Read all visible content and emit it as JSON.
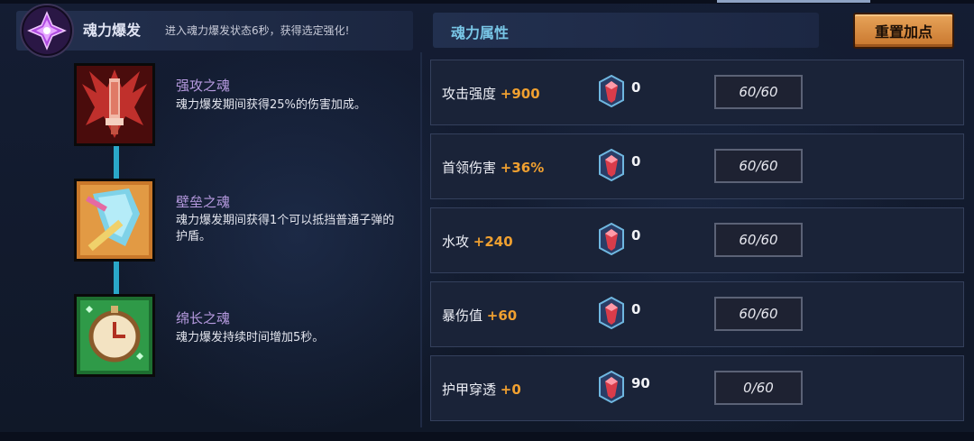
{
  "left_panel": {
    "title": "魂力爆发",
    "description": "进入魂力爆发状态6秒，获得选定强化!",
    "souls": [
      {
        "name": "强攻之魂",
        "description": "魂力爆发期间获得25%的伤害加成。",
        "icon": "attack-soul-icon",
        "frame_color": "#5a1010"
      },
      {
        "name": "壁垒之魂",
        "description": "魂力爆发期间获得1个可以抵挡普通子弹的护盾。",
        "icon": "shield-soul-icon",
        "frame_color": "#b5641f"
      },
      {
        "name": "绵长之魂",
        "description": "魂力爆发持续时间增加5秒。",
        "icon": "clock-soul-icon",
        "frame_color": "#1f7a34"
      }
    ]
  },
  "right_panel": {
    "title": "魂力属性",
    "reset_label": "重置加点",
    "attributes": [
      {
        "label": "攻击强度",
        "bonus": "+900",
        "gem_count": "0",
        "progress": "60/60"
      },
      {
        "label": "首领伤害",
        "bonus": "+36%",
        "gem_count": "0",
        "progress": "60/60"
      },
      {
        "label": "水攻",
        "bonus": "+240",
        "gem_count": "0",
        "progress": "60/60"
      },
      {
        "label": "暴伤值",
        "bonus": "+60",
        "gem_count": "0",
        "progress": "60/60"
      },
      {
        "label": "护甲穿透",
        "bonus": "+0",
        "gem_count": "90",
        "progress": "0/60"
      }
    ]
  },
  "colors": {
    "accent_orange": "#f0a030",
    "title_cyan": "#78c6e6",
    "soul_name_purple": "#b69adf",
    "connector_cyan": "#2aa8c9"
  }
}
